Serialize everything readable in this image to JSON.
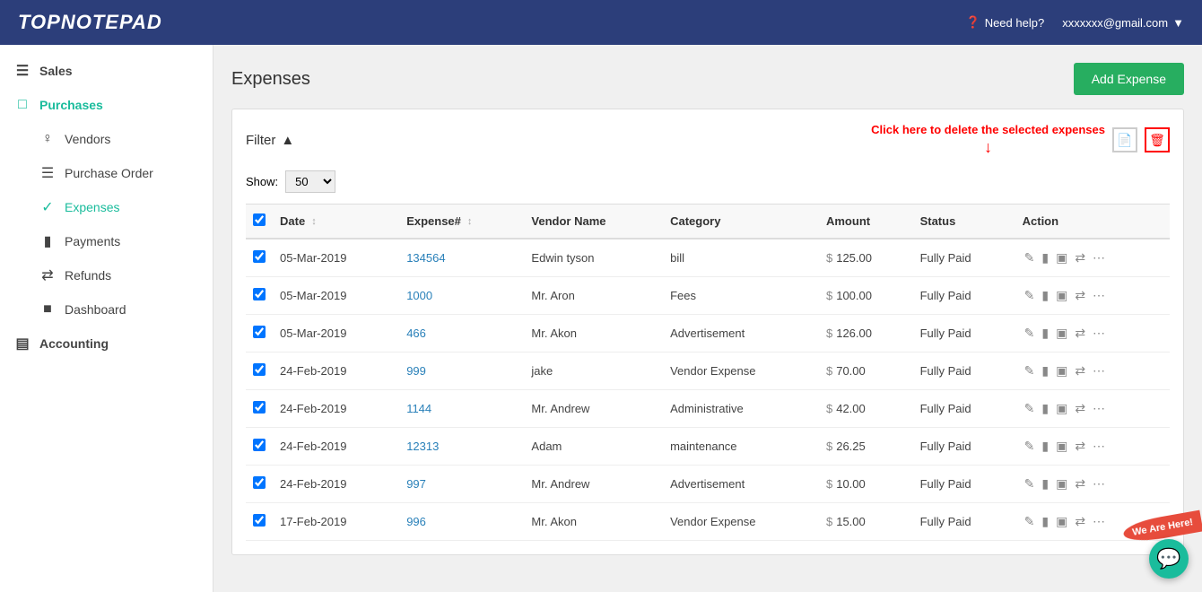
{
  "header": {
    "logo": "TopNotepad",
    "help_label": "Need help?",
    "user_email": "xxxxxxx@gmail.com",
    "help_icon": "?",
    "user_icon": "▼"
  },
  "sidebar": {
    "sales_label": "Sales",
    "purchases_label": "Purchases",
    "vendors_label": "Vendors",
    "purchase_order_label": "Purchase Order",
    "expenses_label": "Expenses",
    "payments_label": "Payments",
    "refunds_label": "Refunds",
    "dashboard_label": "Dashboard",
    "accounting_label": "Accounting"
  },
  "page": {
    "title": "Expenses",
    "add_button": "Add Expense"
  },
  "filter": {
    "label": "Filter",
    "show_label": "Show:",
    "show_value": "50",
    "delete_instruction": "Click here to delete the selected expenses"
  },
  "table": {
    "columns": [
      "",
      "Date",
      "Expense#",
      "Vendor Name",
      "Category",
      "Amount",
      "Status",
      "Action"
    ],
    "rows": [
      {
        "checked": true,
        "date": "05-Mar-2019",
        "expense_num": "134564",
        "vendor": "Edwin tyson",
        "category": "bill",
        "amount": "125.00",
        "status": "Fully Paid"
      },
      {
        "checked": true,
        "date": "05-Mar-2019",
        "expense_num": "1000",
        "vendor": "Mr. Aron",
        "category": "Fees",
        "amount": "100.00",
        "status": "Fully Paid"
      },
      {
        "checked": true,
        "date": "05-Mar-2019",
        "expense_num": "466",
        "vendor": "Mr. Akon",
        "category": "Advertisement",
        "amount": "126.00",
        "status": "Fully Paid"
      },
      {
        "checked": true,
        "date": "24-Feb-2019",
        "expense_num": "999",
        "vendor": "jake",
        "category": "Vendor Expense",
        "amount": "70.00",
        "status": "Fully Paid"
      },
      {
        "checked": true,
        "date": "24-Feb-2019",
        "expense_num": "1144",
        "vendor": "Mr. Andrew",
        "category": "Administrative",
        "amount": "42.00",
        "status": "Fully Paid"
      },
      {
        "checked": true,
        "date": "24-Feb-2019",
        "expense_num": "12313",
        "vendor": "Adam",
        "category": "maintenance",
        "amount": "26.25",
        "status": "Fully Paid"
      },
      {
        "checked": true,
        "date": "24-Feb-2019",
        "expense_num": "997",
        "vendor": "Mr. Andrew",
        "category": "Advertisement",
        "amount": "10.00",
        "status": "Fully Paid"
      },
      {
        "checked": true,
        "date": "17-Feb-2019",
        "expense_num": "996",
        "vendor": "Mr. Akon",
        "category": "Vendor Expense",
        "amount": "15.00",
        "status": "Fully Paid"
      }
    ]
  },
  "badges": {
    "we_are_here": "We Are Here!"
  }
}
